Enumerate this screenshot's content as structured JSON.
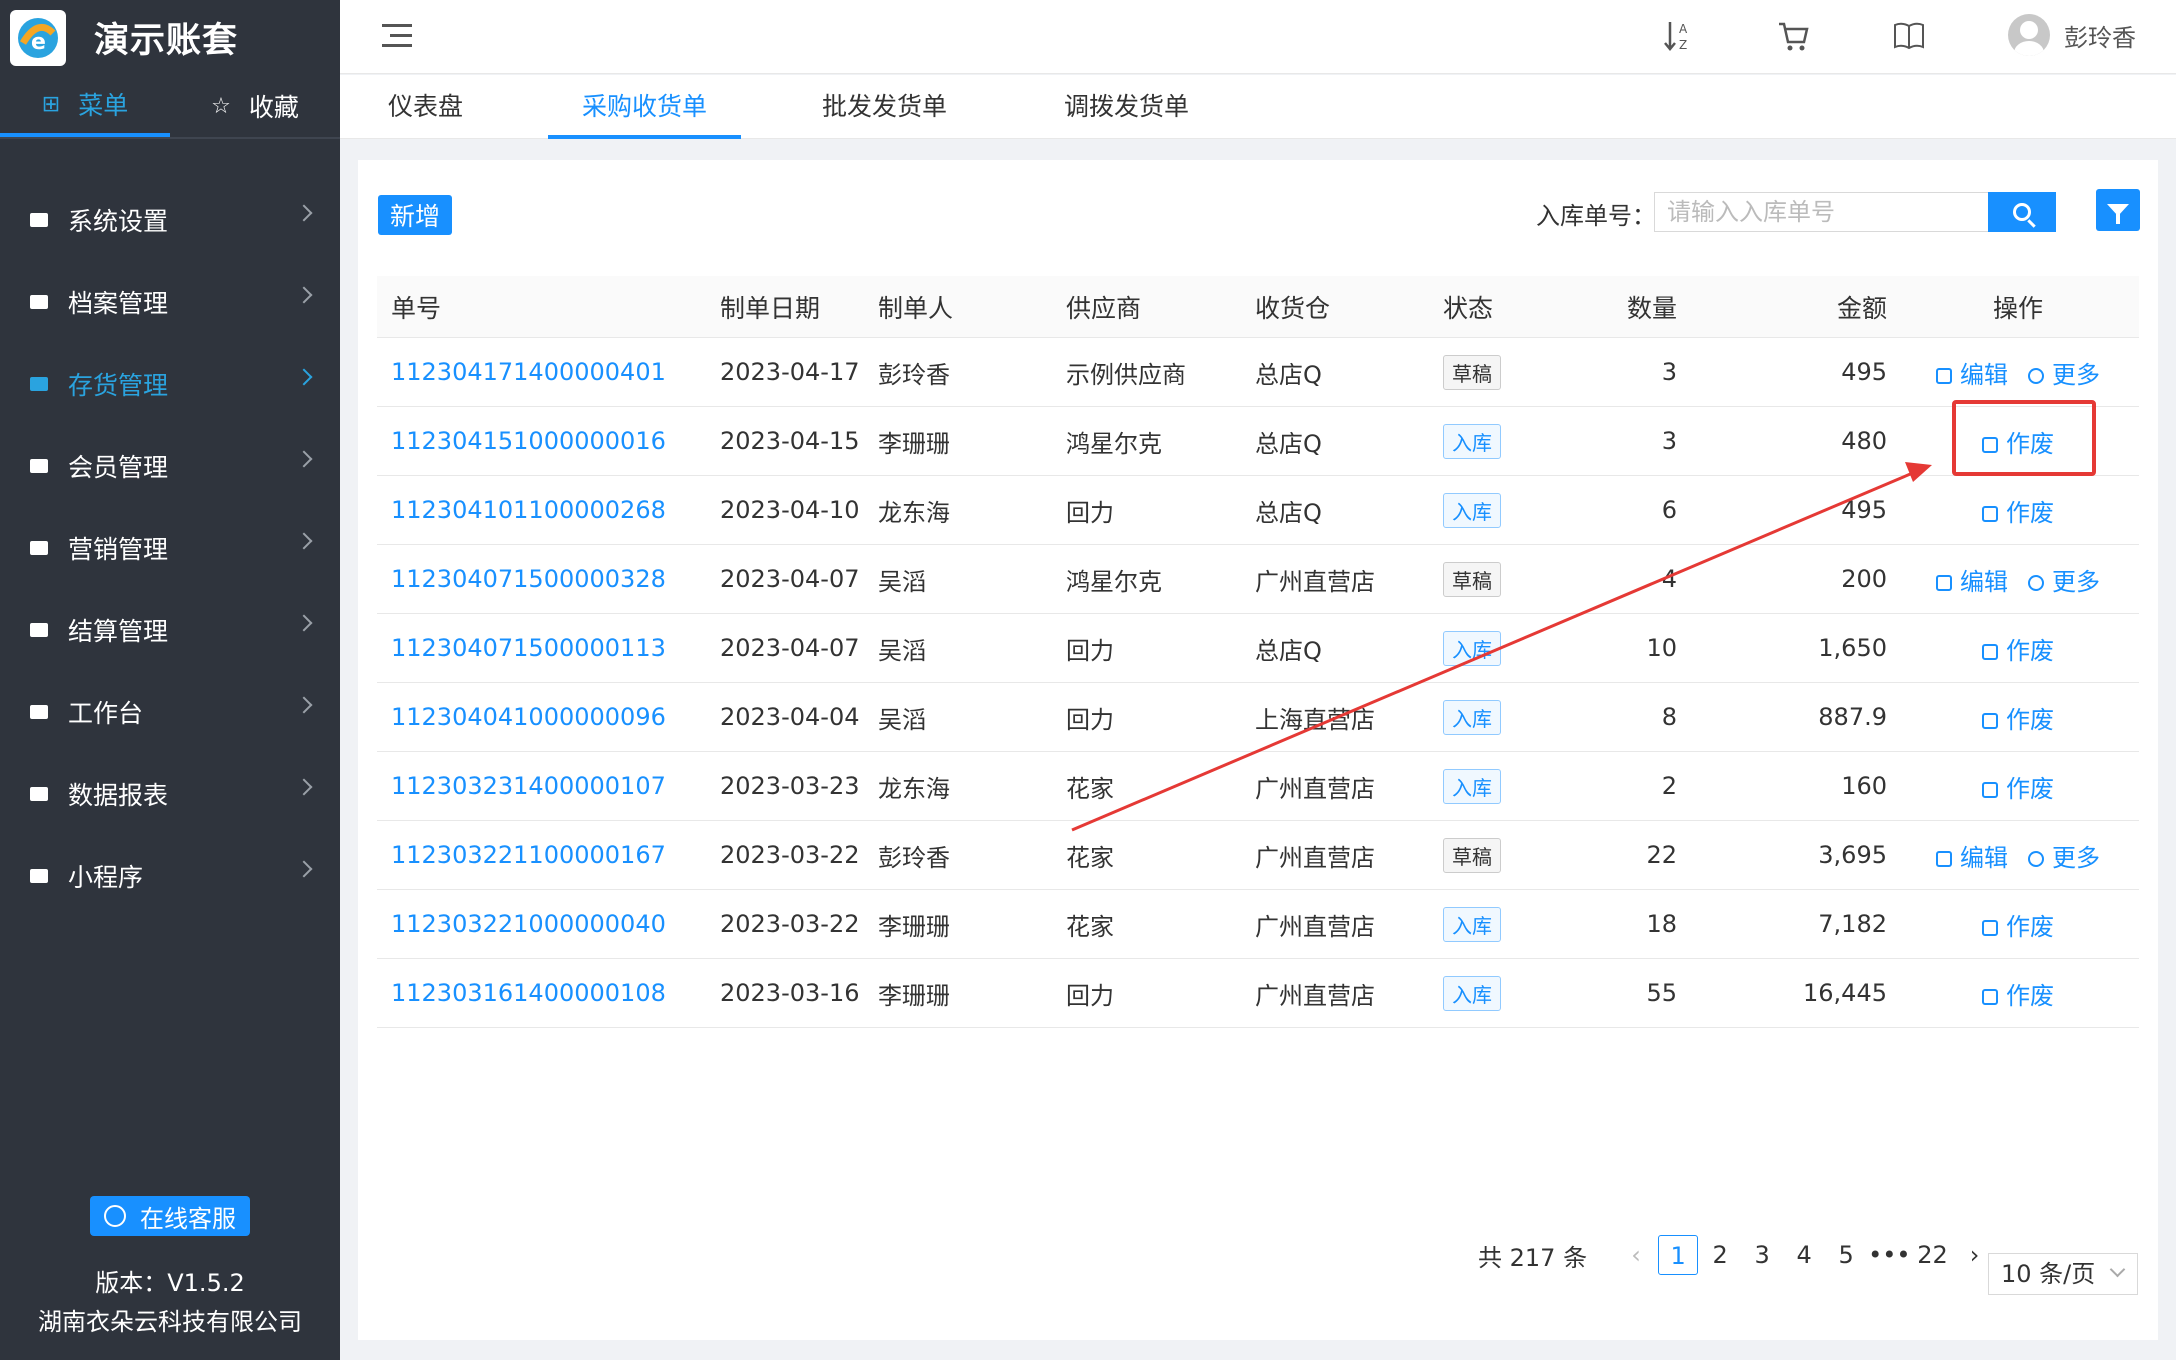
{
  "sidebar": {
    "app_title": "演示账套",
    "tabs": [
      {
        "label": "菜单",
        "icon": "grid-icon"
      },
      {
        "label": "收藏",
        "icon": "star-icon"
      }
    ],
    "menu": [
      {
        "label": "系统设置",
        "name": "system-settings"
      },
      {
        "label": "档案管理",
        "name": "archive-management"
      },
      {
        "label": "存货管理",
        "name": "inventory-management",
        "active": true
      },
      {
        "label": "会员管理",
        "name": "member-management"
      },
      {
        "label": "营销管理",
        "name": "marketing-management"
      },
      {
        "label": "结算管理",
        "name": "settlement-management"
      },
      {
        "label": "工作台",
        "name": "workbench"
      },
      {
        "label": "数据报表",
        "name": "data-reports"
      },
      {
        "label": "小程序",
        "name": "mini-program"
      }
    ],
    "service_label": "在线客服",
    "version": "版本：V1.5.2",
    "company": "湖南衣朵云科技有限公司"
  },
  "header": {
    "user_name": "彭玲香",
    "icons": [
      "sort-az-icon",
      "cart-icon",
      "book-icon"
    ]
  },
  "page_tabs": [
    "仪表盘",
    "采购收货单",
    "批发发货单",
    "调拨发货单"
  ],
  "active_tab": 1,
  "toolbar": {
    "add_label": "新增",
    "search_label": "入库单号：",
    "search_placeholder": "请输入入库单号"
  },
  "table": {
    "headers": {
      "no": "单号",
      "date": "制单日期",
      "maker": "制单人",
      "supplier": "供应商",
      "warehouse": "收货仓",
      "status": "状态",
      "qty": "数量",
      "amount": "金额",
      "ops": "操作"
    },
    "rows": [
      {
        "no": "112304171400000401",
        "date": "2023-04-17",
        "maker": "彭玲香",
        "supplier": "示例供应商",
        "warehouse": "总店Q",
        "status": "草稿",
        "qty": "3",
        "amount": "495",
        "ops": [
          "编辑",
          "更多"
        ]
      },
      {
        "no": "112304151000000016",
        "date": "2023-04-15",
        "maker": "李珊珊",
        "supplier": "鸿星尔克",
        "warehouse": "总店Q",
        "status": "入库",
        "qty": "3",
        "amount": "480",
        "ops": [
          "作废"
        ]
      },
      {
        "no": "112304101100000268",
        "date": "2023-04-10",
        "maker": "龙东海",
        "supplier": "回力",
        "warehouse": "总店Q",
        "status": "入库",
        "qty": "6",
        "amount": "495",
        "ops": [
          "作废"
        ]
      },
      {
        "no": "112304071500000328",
        "date": "2023-04-07",
        "maker": "吴滔",
        "supplier": "鸿星尔克",
        "warehouse": "广州直营店",
        "status": "草稿",
        "qty": "4",
        "amount": "200",
        "ops": [
          "编辑",
          "更多"
        ]
      },
      {
        "no": "112304071500000113",
        "date": "2023-04-07",
        "maker": "吴滔",
        "supplier": "回力",
        "warehouse": "总店Q",
        "status": "入库",
        "qty": "10",
        "amount": "1,650",
        "ops": [
          "作废"
        ]
      },
      {
        "no": "112304041000000096",
        "date": "2023-04-04",
        "maker": "吴滔",
        "supplier": "回力",
        "warehouse": "上海直营店",
        "status": "入库",
        "qty": "8",
        "amount": "887.9",
        "ops": [
          "作废"
        ]
      },
      {
        "no": "112303231400000107",
        "date": "2023-03-23",
        "maker": "龙东海",
        "supplier": "花家",
        "warehouse": "广州直营店",
        "status": "入库",
        "qty": "2",
        "amount": "160",
        "ops": [
          "作废"
        ]
      },
      {
        "no": "112303221100000167",
        "date": "2023-03-22",
        "maker": "彭玲香",
        "supplier": "花家",
        "warehouse": "广州直营店",
        "status": "草稿",
        "qty": "22",
        "amount": "3,695",
        "ops": [
          "编辑",
          "更多"
        ]
      },
      {
        "no": "112303221000000040",
        "date": "2023-03-22",
        "maker": "李珊珊",
        "supplier": "花家",
        "warehouse": "广州直营店",
        "status": "入库",
        "qty": "18",
        "amount": "7,182",
        "ops": [
          "作废"
        ]
      },
      {
        "no": "112303161400000108",
        "date": "2023-03-16",
        "maker": "李珊珊",
        "supplier": "回力",
        "warehouse": "广州直营店",
        "status": "入库",
        "qty": "55",
        "amount": "16,445",
        "ops": [
          "作废"
        ]
      }
    ]
  },
  "pagination": {
    "total": "共 217 条",
    "pages": [
      "1",
      "2",
      "3",
      "4",
      "5",
      "•••",
      "22"
    ],
    "current": "1",
    "page_size": "10 条/页"
  },
  "colors": {
    "accent": "#1890ff",
    "sidebar_bg": "#2f343d",
    "annotation": "#e53935"
  }
}
